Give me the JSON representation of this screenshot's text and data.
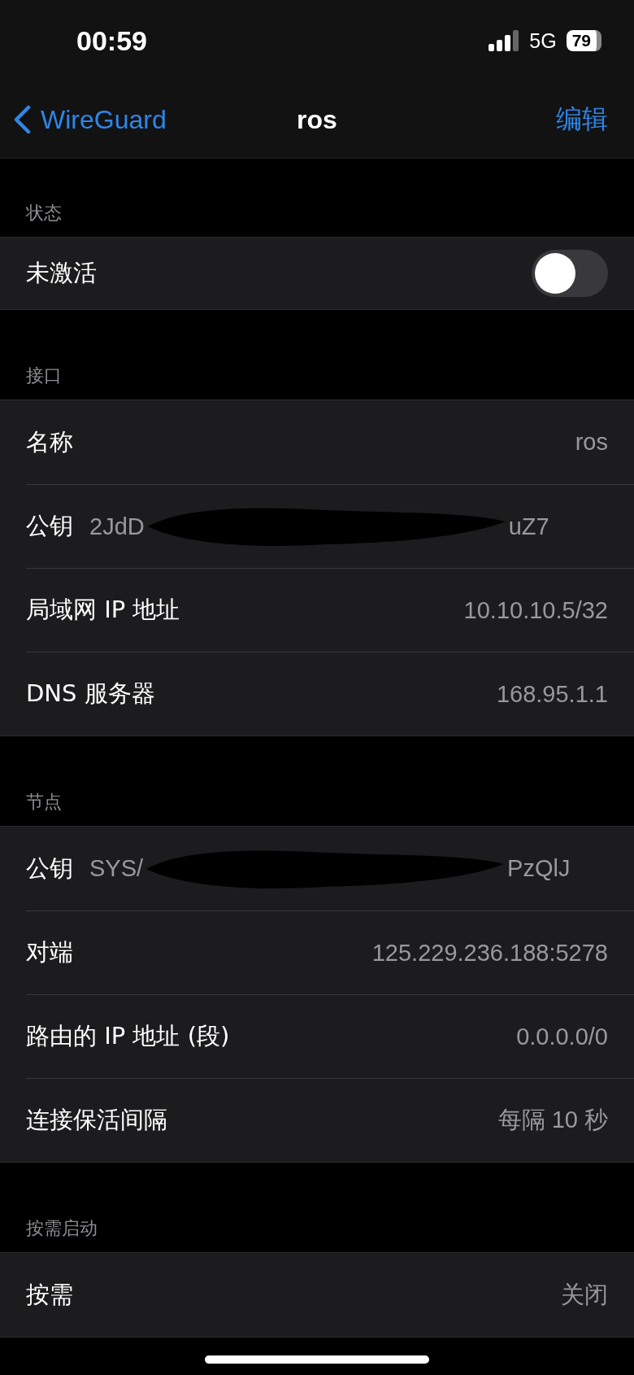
{
  "status_bar": {
    "time": "00:59",
    "network": "5G",
    "battery": "79"
  },
  "nav": {
    "back": "WireGuard",
    "title": "ros",
    "action": "编辑"
  },
  "sections": [
    {
      "header": "状态",
      "rows": [
        {
          "kind": "toggle",
          "label": "未激活",
          "on": false
        }
      ]
    },
    {
      "header": "接口",
      "rows": [
        {
          "kind": "value",
          "label": "名称",
          "value": "ros"
        },
        {
          "kind": "key",
          "label": "公钥",
          "value_start": "2JdD",
          "value_end": "uZ7"
        },
        {
          "kind": "value",
          "label": "局域网 IP 地址",
          "value": "10.10.10.5/32"
        },
        {
          "kind": "value",
          "label": "DNS 服务器",
          "value": "168.95.1.1"
        }
      ]
    },
    {
      "header": "节点",
      "rows": [
        {
          "kind": "key",
          "label": "公钥",
          "value_start": "SYS/",
          "value_end": "PzQlJ"
        },
        {
          "kind": "value",
          "label": "对端",
          "value": "125.229.236.188:5278"
        },
        {
          "kind": "value",
          "label": "路由的 IP 地址 (段)",
          "value": "0.0.0.0/0"
        },
        {
          "kind": "value",
          "label": "连接保活间隔",
          "value": "每隔 10 秒"
        }
      ]
    },
    {
      "header": "按需启动",
      "rows": [
        {
          "kind": "value",
          "label": "按需",
          "value": "关闭"
        }
      ]
    }
  ]
}
